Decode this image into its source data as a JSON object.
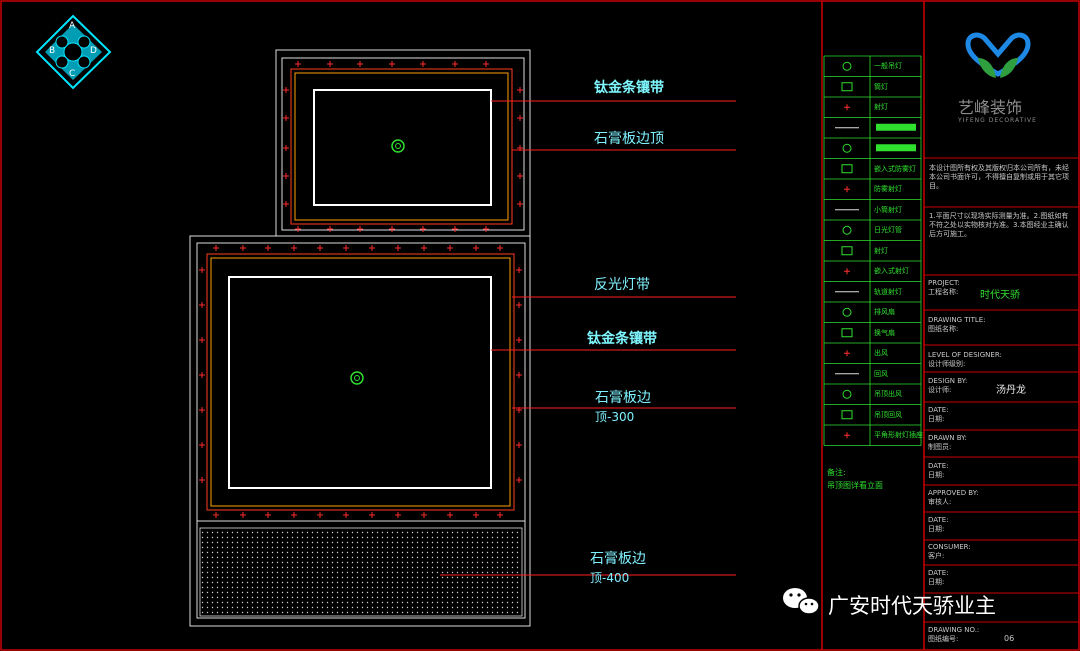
{
  "compass": {
    "letters": [
      "A",
      "B",
      "C",
      "D"
    ]
  },
  "annotations": {
    "top_titanium": "钛金条镶带",
    "top_gypsum": "石膏板边顶",
    "reflect_strip": "反光灯带",
    "mid_titanium": "钛金条镶带",
    "mid_gypsum_line1": "石膏板边",
    "mid_gypsum_line2": "顶-300",
    "bottom_gypsum_line1": "石膏板边",
    "bottom_gypsum_line2": "顶-400"
  },
  "legend": {
    "items": [
      "一般吊灯",
      "筒灯",
      "射灯",
      "",
      "",
      "嵌入式防雾灯",
      "防雾射灯",
      "小筒射灯",
      "日光灯管",
      "射灯",
      "嵌入式射灯",
      "轨道射灯",
      "排风扇",
      "换气扇",
      "出风",
      "回风",
      "吊顶出风",
      "吊顶回风",
      "平角形射灯插座"
    ],
    "note_title": "备注:",
    "note_text": "吊顶图详看立面"
  },
  "titleblock": {
    "brand_cn": "艺峰装饰",
    "brand_en": "YIFENG DECORATIVE",
    "notice": "本设计图所有权及其版权归本公司所有，未经本公司书面许可，不得擅自复制或用于其它项目。",
    "notes": "1.平面尺寸以现场实际测量为准。2.图纸如有不符之处以实物核对为准。3.本图经业主确认后方可施工。",
    "project_label": "PROJECT:",
    "project_cn": "工程名称:",
    "project_value": "时代天骄",
    "drawing_title_label": "DRAWING TITLE:",
    "drawing_title_cn": "图纸名称:",
    "level_label": "LEVEL OF DESIGNER:",
    "level_cn": "设计师级别:",
    "design_label": "DESIGN BY:",
    "design_cn": "设计师:",
    "design_value": "汤丹龙",
    "date_label": "DATE:",
    "date_cn": "日期:",
    "drawn_label": "DRAWN BY:",
    "drawn_cn": "制图员:",
    "approved_label": "APPROVED BY:",
    "approved_cn": "审核人:",
    "consumer_label": "CONSUMER:",
    "consumer_cn": "客户:",
    "drawing_no_label": "DRAWING NO.:",
    "drawing_no_cn": "图纸编号:",
    "drawing_no_value": "06"
  },
  "watermark": {
    "text": "广安时代天骄业主"
  },
  "colors": {
    "green": "#2fe02f",
    "cyan": "#00ffff",
    "red": "#ff0000",
    "orange": "#ffa000",
    "yellow": "#ffd400"
  }
}
